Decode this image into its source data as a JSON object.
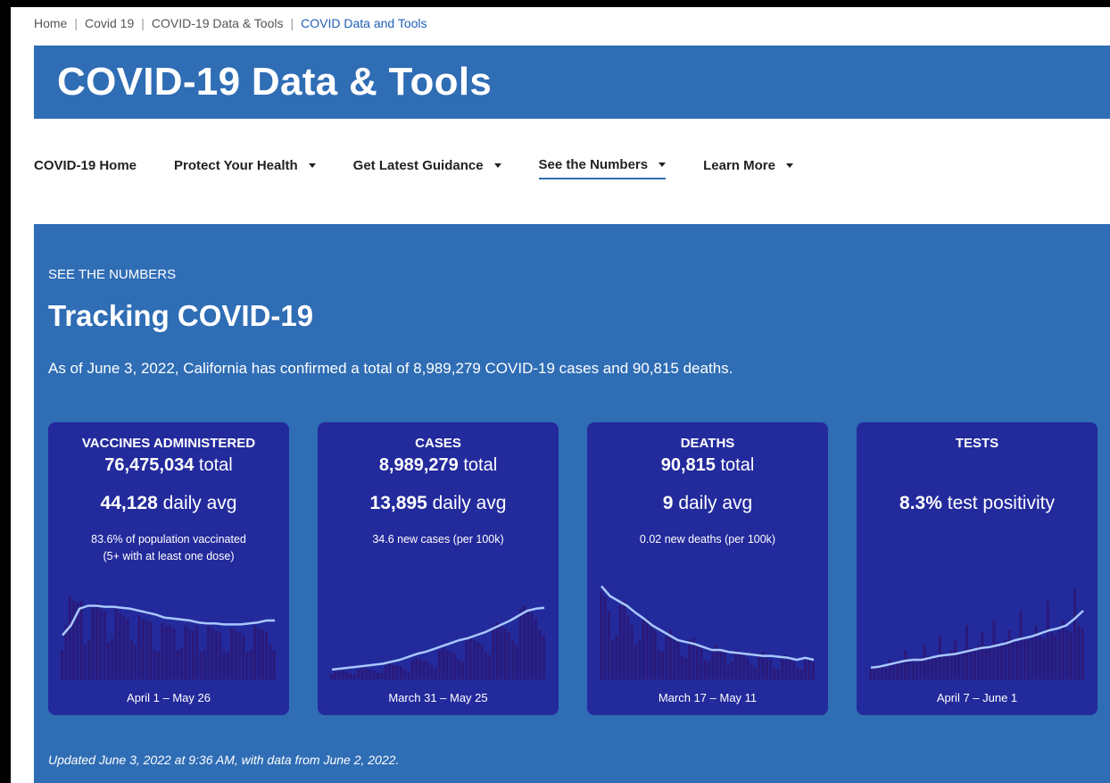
{
  "breadcrumb": {
    "items": [
      "Home",
      "Covid 19",
      "COVID-19 Data & Tools"
    ],
    "current": "COVID Data and Tools"
  },
  "banner": {
    "title": "COVID-19 Data & Tools"
  },
  "nav": {
    "items": [
      {
        "label": "COVID-19 Home",
        "dropdown": false
      },
      {
        "label": "Protect Your Health",
        "dropdown": true
      },
      {
        "label": "Get Latest Guidance",
        "dropdown": true
      },
      {
        "label": "See the Numbers",
        "dropdown": true,
        "active": true
      },
      {
        "label": "Learn More",
        "dropdown": true
      }
    ]
  },
  "section": {
    "eyebrow": "SEE THE NUMBERS",
    "title": "Tracking COVID-19",
    "summary": "As of June 3, 2022, California has confirmed a total of 8,989,279 COVID-19 cases and 90,815 deaths.",
    "updated": "Updated June 3, 2022 at 9:36 AM, with data from June 2, 2022."
  },
  "colors": {
    "banner": "#2f6db5",
    "card": "#232a9c",
    "bars": "#2a1a7a",
    "trend_line": "#a8c8ff"
  },
  "cards": [
    {
      "title": "VACCINES ADMINISTERED",
      "total_value": "76,475,034",
      "total_unit": "total",
      "avg_value": "44,128",
      "avg_unit": "daily avg",
      "note1": "83.6% of population vaccinated",
      "note2": "(5+ with at least one dose)",
      "range": "April 1 – May 26",
      "spark": {
        "bars": [
          0.3,
          0.55,
          0.85,
          0.8,
          0.78,
          0.8,
          0.35,
          0.4,
          0.75,
          0.78,
          0.72,
          0.7,
          0.38,
          0.42,
          0.72,
          0.68,
          0.65,
          0.62,
          0.4,
          0.35,
          0.65,
          0.62,
          0.6,
          0.58,
          0.3,
          0.28,
          0.58,
          0.55,
          0.55,
          0.52,
          0.3,
          0.32,
          0.55,
          0.52,
          0.5,
          0.55,
          0.28,
          0.3,
          0.55,
          0.52,
          0.5,
          0.48,
          0.3,
          0.28,
          0.52,
          0.5,
          0.48,
          0.45,
          0.28,
          0.3,
          0.55,
          0.52,
          0.5,
          0.48,
          0.35,
          0.3
        ],
        "trend": [
          0.45,
          0.55,
          0.72,
          0.75,
          0.75,
          0.74,
          0.74,
          0.73,
          0.72,
          0.7,
          0.68,
          0.66,
          0.63,
          0.62,
          0.61,
          0.6,
          0.58,
          0.57,
          0.57,
          0.56,
          0.56,
          0.56,
          0.57,
          0.58,
          0.6,
          0.6
        ]
      }
    },
    {
      "title": "CASES",
      "total_value": "8,989,279",
      "total_unit": "total",
      "avg_value": "13,895",
      "avg_unit": "daily avg",
      "note1": "34.6 new cases (per 100k)",
      "note2": "",
      "range": "March 31 – May 25",
      "spark": {
        "bars": [
          0.05,
          0.08,
          0.1,
          0.09,
          0.08,
          0.06,
          0.05,
          0.1,
          0.12,
          0.11,
          0.1,
          0.09,
          0.07,
          0.06,
          0.14,
          0.16,
          0.15,
          0.14,
          0.13,
          0.1,
          0.08,
          0.2,
          0.22,
          0.21,
          0.19,
          0.18,
          0.14,
          0.12,
          0.3,
          0.32,
          0.3,
          0.28,
          0.26,
          0.2,
          0.18,
          0.4,
          0.42,
          0.4,
          0.38,
          0.35,
          0.28,
          0.25,
          0.55,
          0.58,
          0.55,
          0.52,
          0.48,
          0.4,
          0.35,
          0.72,
          0.75,
          0.7,
          0.68,
          0.62,
          0.5,
          0.45
        ],
        "trend": [
          0.1,
          0.11,
          0.12,
          0.13,
          0.14,
          0.15,
          0.16,
          0.18,
          0.2,
          0.23,
          0.26,
          0.28,
          0.31,
          0.34,
          0.37,
          0.4,
          0.42,
          0.45,
          0.48,
          0.52,
          0.56,
          0.6,
          0.65,
          0.7,
          0.72,
          0.73
        ]
      }
    },
    {
      "title": "DEATHS",
      "total_value": "90,815",
      "total_unit": "total",
      "avg_value": "9",
      "avg_unit": "daily avg",
      "note1": "0.02 new deaths (per 100k)",
      "note2": "",
      "range": "March 17 – May 11",
      "spark": {
        "bars": [
          0.9,
          0.85,
          0.7,
          0.4,
          0.45,
          0.75,
          0.8,
          0.65,
          0.55,
          0.35,
          0.4,
          0.6,
          0.62,
          0.55,
          0.5,
          0.3,
          0.28,
          0.45,
          0.5,
          0.42,
          0.4,
          0.25,
          0.22,
          0.4,
          0.42,
          0.35,
          0.33,
          0.2,
          0.18,
          0.3,
          0.35,
          0.3,
          0.28,
          0.15,
          0.18,
          0.3,
          0.28,
          0.25,
          0.22,
          0.15,
          0.12,
          0.25,
          0.28,
          0.22,
          0.2,
          0.12,
          0.1,
          0.22,
          0.25,
          0.2,
          0.18,
          0.12,
          0.1,
          0.2,
          0.22,
          0.18
        ],
        "trend": [
          0.95,
          0.85,
          0.8,
          0.75,
          0.68,
          0.62,
          0.55,
          0.5,
          0.45,
          0.4,
          0.38,
          0.36,
          0.33,
          0.3,
          0.3,
          0.28,
          0.27,
          0.26,
          0.25,
          0.24,
          0.24,
          0.23,
          0.22,
          0.2,
          0.22,
          0.2
        ]
      }
    },
    {
      "title": "TESTS",
      "total_value": "",
      "total_unit": "",
      "avg_value": "8.3%",
      "avg_unit": "test positivity",
      "note1": "",
      "note2": "",
      "range": "April 7 – June 1",
      "spark": {
        "bars": [
          0.1,
          0.12,
          0.14,
          0.13,
          0.12,
          0.2,
          0.15,
          0.16,
          0.18,
          0.3,
          0.2,
          0.18,
          0.17,
          0.22,
          0.35,
          0.24,
          0.22,
          0.25,
          0.45,
          0.26,
          0.25,
          0.3,
          0.4,
          0.28,
          0.27,
          0.55,
          0.32,
          0.3,
          0.35,
          0.48,
          0.34,
          0.32,
          0.6,
          0.38,
          0.36,
          0.4,
          0.5,
          0.4,
          0.38,
          0.7,
          0.42,
          0.4,
          0.45,
          0.55,
          0.44,
          0.42,
          0.8,
          0.48,
          0.46,
          0.5,
          0.6,
          0.5,
          0.48,
          0.92,
          0.55,
          0.52
        ],
        "trend": [
          0.12,
          0.13,
          0.15,
          0.17,
          0.19,
          0.2,
          0.2,
          0.22,
          0.24,
          0.25,
          0.26,
          0.28,
          0.3,
          0.32,
          0.33,
          0.35,
          0.37,
          0.4,
          0.42,
          0.44,
          0.47,
          0.5,
          0.52,
          0.55,
          0.62,
          0.7
        ]
      }
    }
  ]
}
